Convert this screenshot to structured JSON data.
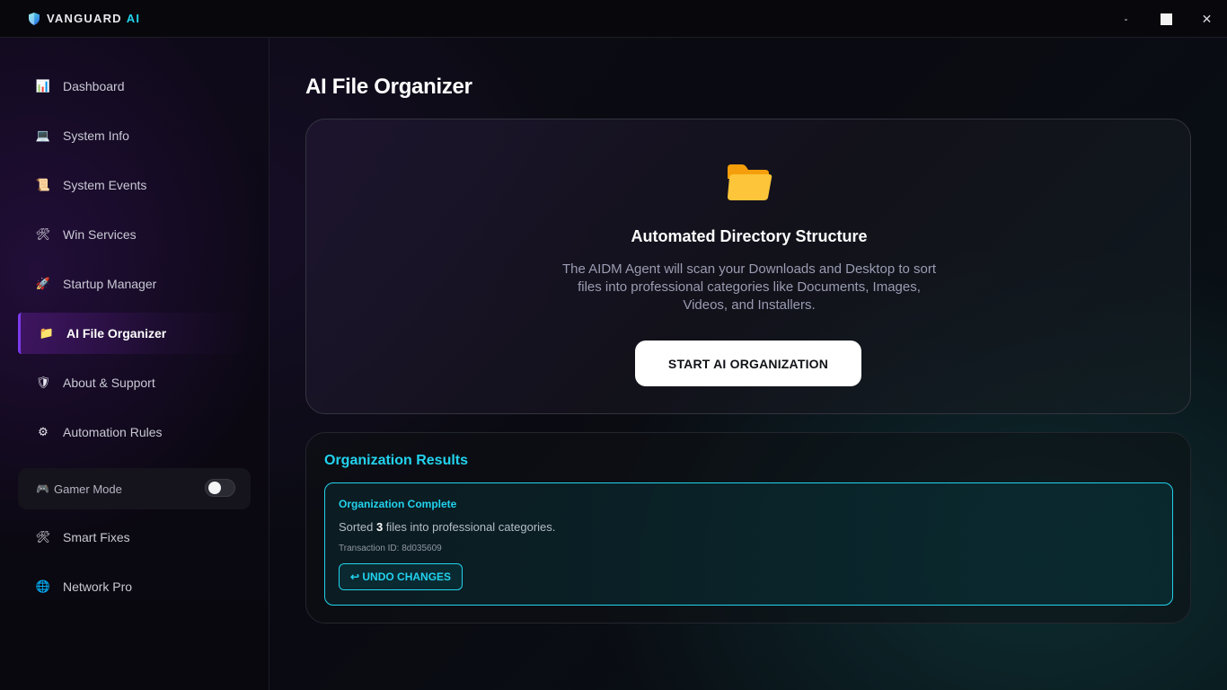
{
  "app": {
    "brand": "VANGUARD",
    "brand_accent": "AI",
    "controls": {
      "minimize": "-",
      "close": "✕"
    }
  },
  "sidebar": {
    "items": [
      {
        "label": "Dashboard",
        "icon": "bar-chart-icon",
        "glyph": "📊"
      },
      {
        "label": "System Info",
        "icon": "laptop-icon",
        "glyph": "💻"
      },
      {
        "label": "System Events",
        "icon": "scroll-icon",
        "glyph": "📜"
      },
      {
        "label": "Win Services",
        "icon": "tools-icon",
        "glyph": "🛠"
      },
      {
        "label": "Startup Manager",
        "icon": "rocket-icon",
        "glyph": "🚀"
      },
      {
        "label": "AI File Organizer",
        "icon": "folder-icon",
        "glyph": "📁",
        "active": true
      },
      {
        "label": "About & Support",
        "icon": "shield-icon",
        "glyph": "🛡"
      },
      {
        "label": "Automation Rules",
        "icon": "gear-icon",
        "glyph": "⚙"
      },
      {
        "label": "Smart Fixes",
        "icon": "tools-icon",
        "glyph": "🛠"
      },
      {
        "label": "Network Pro",
        "icon": "globe-icon",
        "glyph": "🌐"
      }
    ],
    "gamer_mode": {
      "label": "Gamer Mode",
      "icon": "gamepad-icon",
      "glyph": "🎮",
      "enabled": false
    }
  },
  "main": {
    "title": "AI File Organizer",
    "card": {
      "icon": "folder-icon",
      "title": "Automated Directory Structure",
      "description": "The AIDM Agent will scan your Downloads and Desktop to sort files into professional categories like Documents, Images, Videos, and Installers.",
      "button": "START AI ORGANIZATION"
    },
    "results": {
      "title": "Organization Results",
      "status_title": "Organization Complete",
      "sorted_prefix": "Sorted",
      "sorted_count": "3",
      "sorted_suffix": "files into professional categories.",
      "transaction": "Transaction ID: 8d035609",
      "undo_button": "↩ UNDO CHANGES"
    }
  },
  "colors": {
    "accent_cyan": "#22d3ee",
    "accent_purple": "#7c3aed",
    "folder_yellow": "#fbbf24"
  }
}
